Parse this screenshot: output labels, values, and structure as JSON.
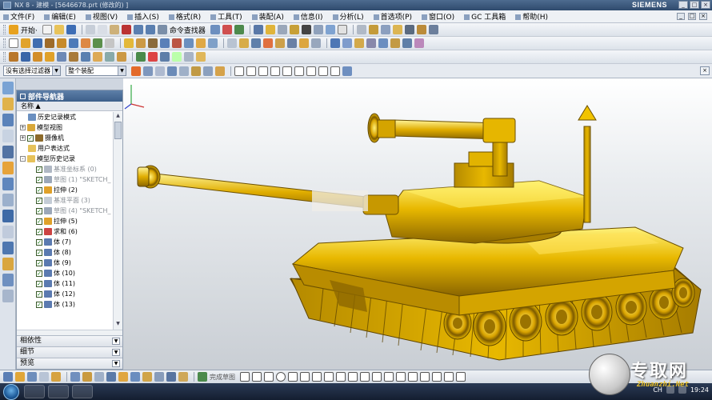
{
  "window": {
    "title": "NX 8 - 建模 - [5646678.prt (修改的) ]",
    "brand": "SIEMENS",
    "controls": [
      "_",
      "□",
      "×"
    ]
  },
  "menu": {
    "items": [
      "文件(F)",
      "编辑(E)",
      "视图(V)",
      "插入(S)",
      "格式(R)",
      "工具(T)",
      "装配(A)",
      "信息(I)",
      "分析(L)",
      "首选项(P)",
      "窗口(O)",
      "GC 工具箱",
      "帮助(H)"
    ],
    "right_controls": [
      "_",
      "□",
      "×"
    ]
  },
  "toolbar": {
    "start_label": "开始·",
    "command_finder_label": "命令查找器"
  },
  "selection": {
    "filter_value": "没有选择过滤器",
    "scope_value": "整个装配"
  },
  "navigator": {
    "title": "部件导航器",
    "column_header": "名称",
    "rows": [
      {
        "label": "历史记录模式",
        "indent": 1,
        "expand": "",
        "check": false,
        "icon": "history-icon",
        "gray": false
      },
      {
        "label": "模型视图",
        "indent": 0,
        "expand": "+",
        "check": false,
        "icon": "model-view-icon",
        "gray": false
      },
      {
        "label": "摄像机",
        "indent": 0,
        "expand": "+",
        "check": true,
        "icon": "camera-icon",
        "gray": false
      },
      {
        "label": "用户表达式",
        "indent": 1,
        "expand": "",
        "check": false,
        "icon": "folder-icon",
        "gray": false
      },
      {
        "label": "模型历史记录",
        "indent": 0,
        "expand": "-",
        "check": false,
        "icon": "folder-icon",
        "gray": false
      },
      {
        "label": "基准坐标系 (0)",
        "indent": 2,
        "expand": "",
        "check": true,
        "icon": "datum-csys-icon",
        "gray": true
      },
      {
        "label": "草图 (1) \"SKETCH_",
        "indent": 2,
        "expand": "",
        "check": true,
        "icon": "sketch-icon",
        "gray": true
      },
      {
        "label": "拉伸 (2)",
        "indent": 2,
        "expand": "",
        "check": true,
        "icon": "extrude-icon",
        "gray": false
      },
      {
        "label": "基准平面 (3)",
        "indent": 2,
        "expand": "",
        "check": true,
        "icon": "datum-plane-icon",
        "gray": true
      },
      {
        "label": "草图 (4) \"SKETCH_",
        "indent": 2,
        "expand": "",
        "check": true,
        "icon": "sketch-icon",
        "gray": true
      },
      {
        "label": "拉伸 (5)",
        "indent": 2,
        "expand": "",
        "check": true,
        "icon": "extrude-icon",
        "gray": false
      },
      {
        "label": "求和 (6)",
        "indent": 2,
        "expand": "",
        "check": true,
        "icon": "unite-icon",
        "gray": false
      },
      {
        "label": "体 (7)",
        "indent": 2,
        "expand": "",
        "check": true,
        "icon": "body-icon",
        "gray": false
      },
      {
        "label": "体 (8)",
        "indent": 2,
        "expand": "",
        "check": true,
        "icon": "body-icon",
        "gray": false
      },
      {
        "label": "体 (9)",
        "indent": 2,
        "expand": "",
        "check": true,
        "icon": "body-icon",
        "gray": false
      },
      {
        "label": "体 (10)",
        "indent": 2,
        "expand": "",
        "check": true,
        "icon": "body-icon",
        "gray": false
      },
      {
        "label": "体 (11)",
        "indent": 2,
        "expand": "",
        "check": true,
        "icon": "body-icon",
        "gray": false
      },
      {
        "label": "体 (12)",
        "indent": 2,
        "expand": "",
        "check": true,
        "icon": "body-icon",
        "gray": false
      },
      {
        "label": "体 (13)",
        "indent": 2,
        "expand": "",
        "check": true,
        "icon": "body-icon",
        "gray": false
      }
    ],
    "panels": [
      "相依性",
      "细节",
      "预览"
    ]
  },
  "bottom_toolbar": {
    "label": "完成草图"
  },
  "taskbar": {
    "lang": "CH",
    "time": "19:24"
  },
  "watermark": {
    "text": "专取网",
    "url": "Zhuanzhi.Net"
  },
  "colors": {
    "model_gold": "#e8b800",
    "model_dark": "#8a6500",
    "navigator_header": "#4a6d98"
  }
}
